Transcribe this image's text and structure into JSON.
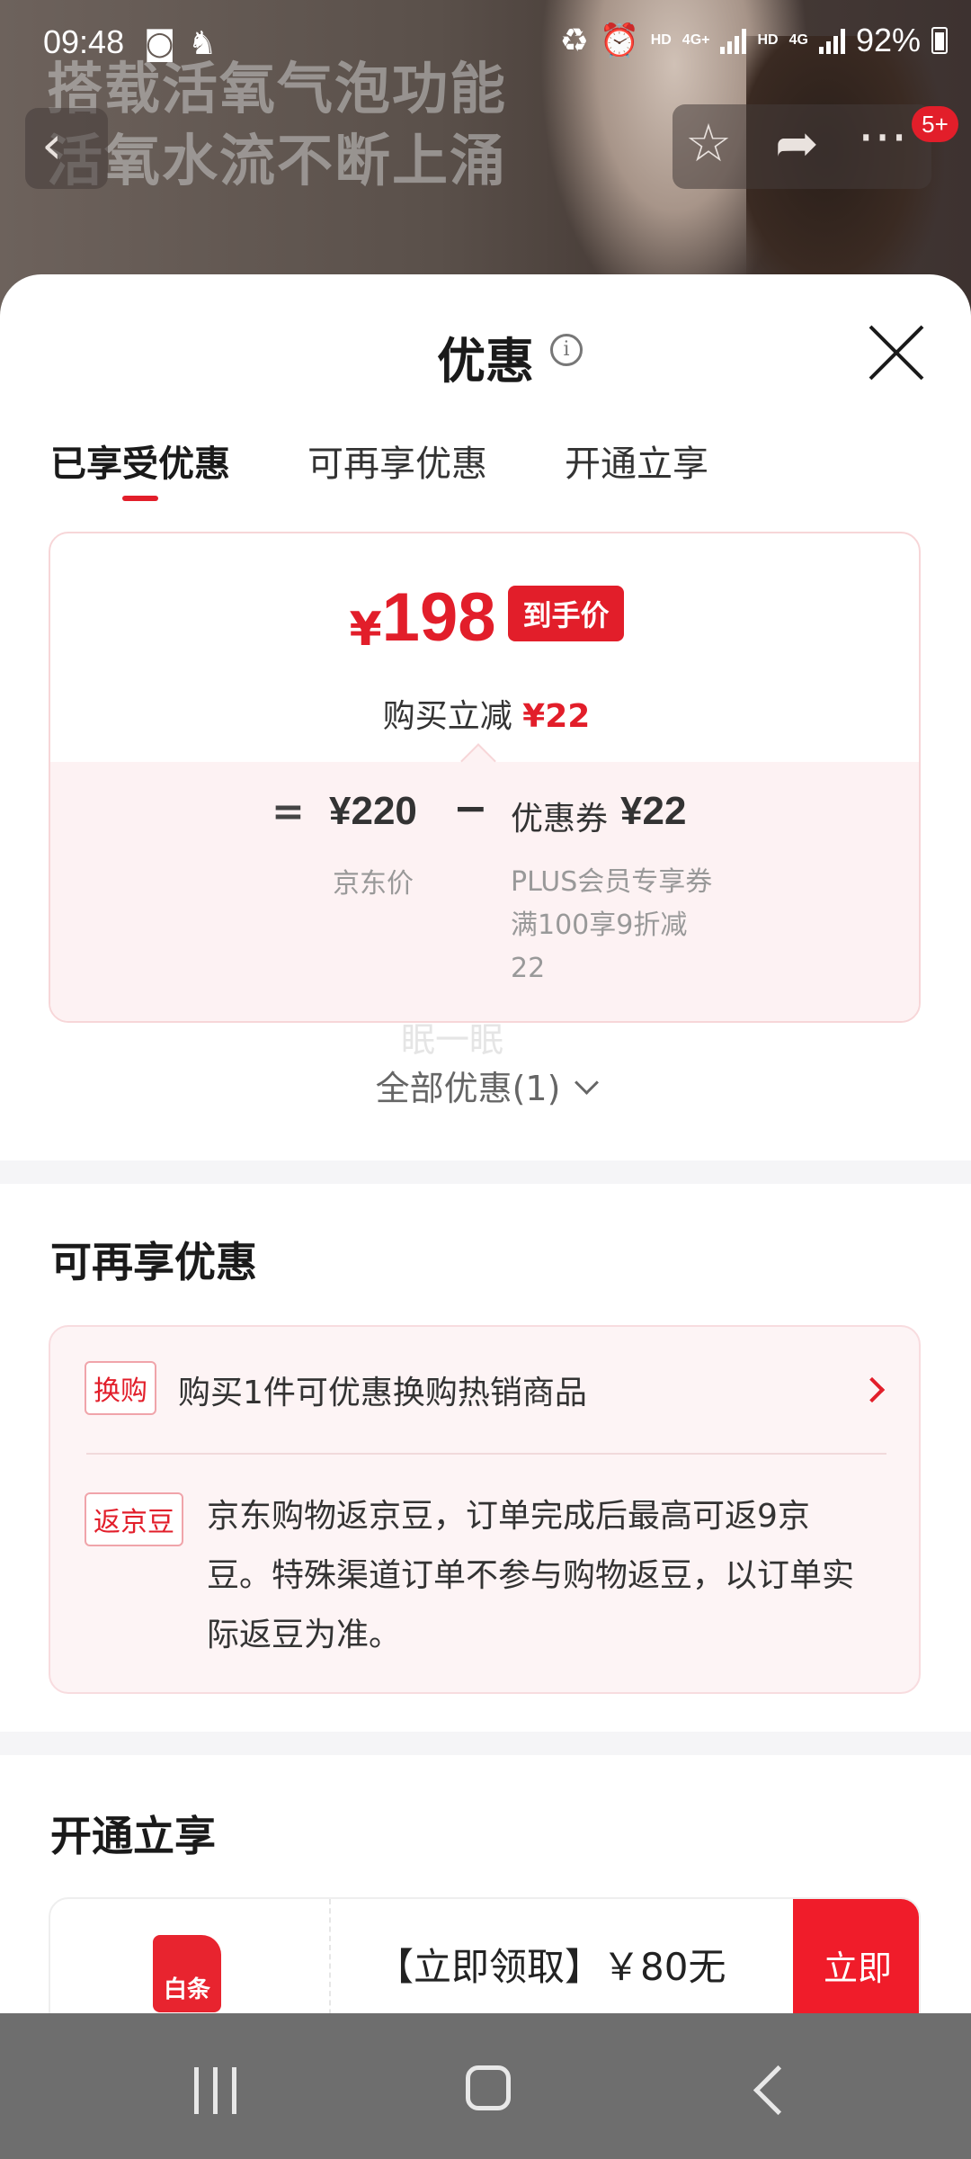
{
  "status_bar": {
    "time": "09:48",
    "hd1": "HD",
    "net": "4G+",
    "hd2": "HD",
    "net2": "4G",
    "battery": "92%"
  },
  "background": {
    "line1": "搭载活氧气泡功能",
    "line2": "活氧水流不断上涌"
  },
  "top_nav": {
    "badge": "5+"
  },
  "sheet": {
    "title": "优惠",
    "tabs": [
      {
        "label": "已享受优惠",
        "active": true
      },
      {
        "label": "可再享优惠",
        "active": false
      },
      {
        "label": "开通立享",
        "active": false
      }
    ]
  },
  "price_card": {
    "currency": "¥",
    "price": "198",
    "tag": "到手价",
    "reduction_label": "购买立减",
    "reduction_value": "¥22",
    "eq": "=",
    "jd_price": "¥220",
    "minus": "−",
    "coupon_label": "优惠券",
    "coupon_value": "¥22",
    "jd_price_label": "京东价",
    "coupon_desc": "PLUS会员专享券满100享9折减22"
  },
  "watermark": "眠一眠",
  "all_offers": "全部优惠(1)",
  "more_offers": {
    "title": "可再享优惠",
    "items": [
      {
        "tag": "换购",
        "text": "购买1件可优惠换购热销商品"
      },
      {
        "tag": "返京豆",
        "text": "京东购物返京豆，订单完成后最高可返9京豆。特殊渠道订单不参与购物返豆，以订单实际返豆为准。"
      }
    ]
  },
  "open_enjoy": {
    "title": "开通立享",
    "logo_text": "白条",
    "offer_text": "【立即领取】￥80无",
    "button": "立即"
  },
  "colors": {
    "accent": "#e21e2a",
    "card_bg": "#fdf2f3",
    "nav_bar": "#6e6e6e"
  }
}
